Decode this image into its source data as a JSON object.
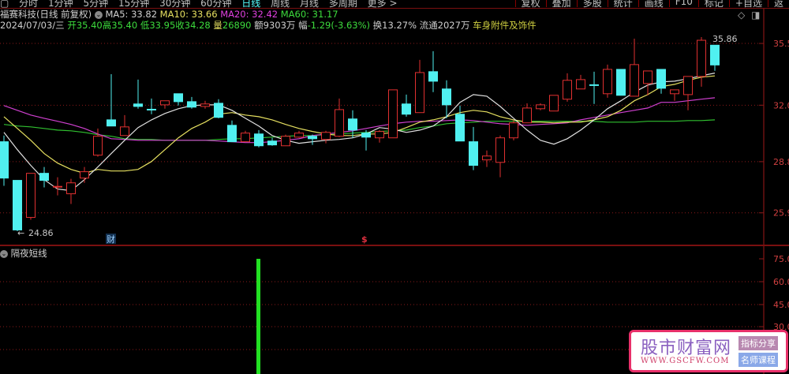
{
  "toolbar": {
    "periods": [
      "分时",
      "1分钟",
      "5分钟",
      "15分钟",
      "30分钟",
      "60分钟",
      "日线",
      "周线",
      "月线",
      "多周期",
      "更多 >"
    ],
    "active_period": "日线",
    "right_tools": [
      "复权",
      "叠加",
      "多股",
      "统计",
      "画线",
      "F10",
      "标记",
      "+自选",
      "返"
    ]
  },
  "header": {
    "stock": "福赛科技(日线 前复权)",
    "ma5": "MA5: 33.82",
    "ma10": "MA10: 33.66",
    "ma20": "MA20: 32.42",
    "ma60": "MA60: 31.17",
    "date": "2024/07/03/三",
    "open": "开35.40",
    "high": "高35.40",
    "low": "低33.95",
    "close": "收34.28",
    "vol_label": "量",
    "vol": "26890",
    "amount": "额9303万",
    "range_label": "幅",
    "range": "-1.29(-3.63%)",
    "turnover": "换13.27%",
    "float": "流通2027万",
    "sector": "车身附件及饰件"
  },
  "icons": {
    "diamond": "diamond-icon",
    "panel": "panel-toggle-icon"
  },
  "price_axis": [
    "35.5",
    "32.0",
    "28.8",
    "25.9"
  ],
  "annotations": {
    "high": "35.86",
    "low": "24.86",
    "finance_marker": "财",
    "dividend_marker": "$"
  },
  "sub_panel": {
    "title": "隔夜短线",
    "axis": [
      "75.0",
      "60.0",
      "45.0",
      "30.0"
    ],
    "bar_value": 76
  },
  "watermark": {
    "title": "股市财富网",
    "url": "WWW.GSCFW.COM",
    "badge1": "指标分享",
    "badge2": "名师课程"
  },
  "colors": {
    "up": "#e03030",
    "down": "#50f0f0",
    "ma5": "#e0e0e0",
    "ma10": "#e6e060",
    "ma20": "#d040d0",
    "ma60": "#30c030",
    "grid": "#8a1a1a"
  },
  "chart_data": {
    "type": "candlestick",
    "price_range": [
      24.86,
      35.86
    ],
    "candles": [
      [
        29.93,
        27.87,
        30.28,
        27.43
      ],
      [
        27.74,
        24.93,
        27.74,
        24.86
      ],
      [
        25.64,
        28.14,
        28.14,
        25.51
      ],
      [
        28.14,
        27.74,
        28.5,
        27.34
      ],
      [
        27.36,
        27.4,
        27.92,
        26.89
      ],
      [
        26.98,
        27.6,
        27.83,
        26.4
      ],
      [
        27.87,
        28.23,
        28.5,
        27.6
      ],
      [
        29.17,
        30.24,
        30.68,
        29.08
      ],
      [
        31.17,
        30.82,
        33.76,
        30.82
      ],
      [
        30.28,
        30.77,
        31.44,
        30.28
      ],
      [
        32.07,
        31.93,
        33.45,
        31.8
      ],
      [
        31.77,
        31.73,
        32.38,
        31.49
      ],
      [
        32.02,
        32.25,
        32.25,
        31.8
      ],
      [
        32.65,
        32.2,
        32.65,
        31.98
      ],
      [
        32.2,
        31.89,
        32.47,
        31.8
      ],
      [
        31.93,
        32.07,
        32.25,
        31.8
      ],
      [
        32.11,
        31.31,
        32.34,
        31.26
      ],
      [
        30.86,
        29.93,
        31.13,
        29.93
      ],
      [
        29.93,
        30.42,
        30.55,
        29.93
      ],
      [
        30.37,
        29.7,
        30.59,
        29.61
      ],
      [
        29.97,
        29.75,
        30.15,
        29.7
      ],
      [
        29.7,
        30.24,
        30.33,
        29.7
      ],
      [
        30.19,
        30.42,
        30.55,
        30.15
      ],
      [
        30.24,
        30.1,
        30.33,
        29.75
      ],
      [
        30.06,
        30.46,
        30.55,
        29.84
      ],
      [
        30.24,
        31.75,
        32.38,
        30.19
      ],
      [
        31.22,
        30.59,
        31.71,
        30.15
      ],
      [
        30.42,
        30.19,
        30.59,
        29.43
      ],
      [
        30.15,
        30.51,
        30.59,
        29.88
      ],
      [
        30.15,
        32.87,
        32.87,
        30.15
      ],
      [
        32.07,
        31.49,
        32.6,
        31.35
      ],
      [
        31.58,
        33.85,
        34.57,
        31.58
      ],
      [
        33.9,
        33.36,
        35.06,
        32.74
      ],
      [
        32.92,
        32.02,
        33.41,
        31.26
      ],
      [
        31.49,
        29.97,
        31.98,
        29.97
      ],
      [
        29.93,
        28.59,
        30.77,
        28.32
      ],
      [
        28.9,
        29.12,
        29.43,
        28.5
      ],
      [
        28.76,
        30.15,
        30.28,
        27.92
      ],
      [
        30.15,
        31.0,
        31.13,
        30.01
      ],
      [
        31.0,
        31.84,
        32.11,
        31.0
      ],
      [
        31.8,
        32.02,
        32.11,
        31.71
      ],
      [
        31.67,
        32.56,
        32.56,
        31.67
      ],
      [
        32.34,
        33.41,
        33.81,
        32.2
      ],
      [
        32.92,
        33.45,
        33.72,
        32.92
      ],
      [
        33.16,
        33.12,
        33.9,
        32.07
      ],
      [
        32.65,
        34.03,
        34.3,
        32.42
      ],
      [
        34.03,
        32.56,
        34.03,
        32.56
      ],
      [
        32.51,
        34.3,
        35.77,
        32.51
      ],
      [
        33.23,
        33.94,
        33.94,
        32.56
      ],
      [
        34.03,
        32.96,
        34.03,
        32.65
      ],
      [
        32.65,
        32.87,
        32.87,
        32.25
      ],
      [
        32.6,
        33.63,
        33.63,
        31.71
      ],
      [
        33.63,
        35.68,
        35.86,
        33.05
      ],
      [
        35.4,
        34.28,
        35.4,
        33.95
      ]
    ],
    "ma5": [
      30.46,
      29.48,
      28.59,
      27.78,
      27.25,
      27.16,
      27.78,
      28.5,
      29.26,
      30.01,
      30.73,
      31.17,
      31.53,
      31.8,
      31.98,
      32.02,
      32.02,
      31.71,
      31.26,
      30.82,
      30.28,
      30.01,
      29.84,
      29.93,
      30.01,
      30.06,
      30.15,
      30.37,
      30.73,
      30.64,
      30.46,
      30.59,
      30.82,
      31.35,
      32.16,
      32.6,
      32.51,
      31.93,
      31.26,
      30.59,
      30.01,
      29.79,
      30.1,
      30.59,
      31.17,
      31.8,
      32.25,
      32.74,
      33.14,
      33.32,
      33.36,
      33.5,
      33.67,
      33.82
    ],
    "ma10": [
      31.35,
      30.68,
      30.01,
      29.26,
      28.72,
      28.36,
      28.14,
      28.36,
      28.27,
      28.27,
      28.36,
      28.81,
      29.48,
      30.15,
      30.68,
      31.04,
      31.49,
      31.58,
      31.44,
      31.35,
      31.17,
      30.91,
      30.68,
      30.51,
      30.37,
      30.28,
      30.28,
      30.37,
      30.37,
      30.46,
      30.73,
      31.04,
      31.17,
      31.35,
      31.58,
      31.71,
      31.62,
      31.35,
      31.17,
      31.04,
      31.04,
      31.0,
      31.04,
      31.04,
      31.17,
      31.35,
      31.71,
      32.25,
      32.6,
      33.05,
      33.18,
      33.41,
      33.59,
      33.66
    ],
    "ma20": [
      31.98,
      31.71,
      31.44,
      31.26,
      31.09,
      30.91,
      30.68,
      30.37,
      30.1,
      30.06,
      30.01,
      30.01,
      30.01,
      30.01,
      30.01,
      30.01,
      29.97,
      29.93,
      29.88,
      29.88,
      29.93,
      30.01,
      30.1,
      30.28,
      30.37,
      30.46,
      30.55,
      30.68,
      30.82,
      30.95,
      31.04,
      31.09,
      31.09,
      31.13,
      31.17,
      31.13,
      31.04,
      30.95,
      30.91,
      30.86,
      30.91,
      30.95,
      31.0,
      31.17,
      31.31,
      31.44,
      31.58,
      31.71,
      31.84,
      32.16,
      32.16,
      32.25,
      32.34,
      32.42
    ],
    "ma60": [
      30.91,
      30.82,
      30.77,
      30.68,
      30.59,
      30.55,
      30.46,
      30.33,
      30.24,
      30.1,
      30.06,
      30.06,
      30.01,
      30.01,
      30.01,
      30.01,
      30.06,
      30.1,
      30.1,
      30.15,
      30.19,
      30.24,
      30.28,
      30.28,
      30.33,
      30.37,
      30.42,
      30.46,
      30.51,
      30.55,
      30.59,
      30.73,
      30.82,
      30.95,
      31.0,
      31.04,
      31.09,
      31.09,
      31.09,
      31.09,
      31.09,
      31.09,
      31.09,
      31.09,
      31.09,
      31.04,
      31.04,
      31.04,
      31.09,
      31.09,
      31.09,
      31.13,
      31.13,
      31.17
    ],
    "axis_ticks": [
      35.5,
      32.0,
      28.8,
      25.9
    ]
  }
}
